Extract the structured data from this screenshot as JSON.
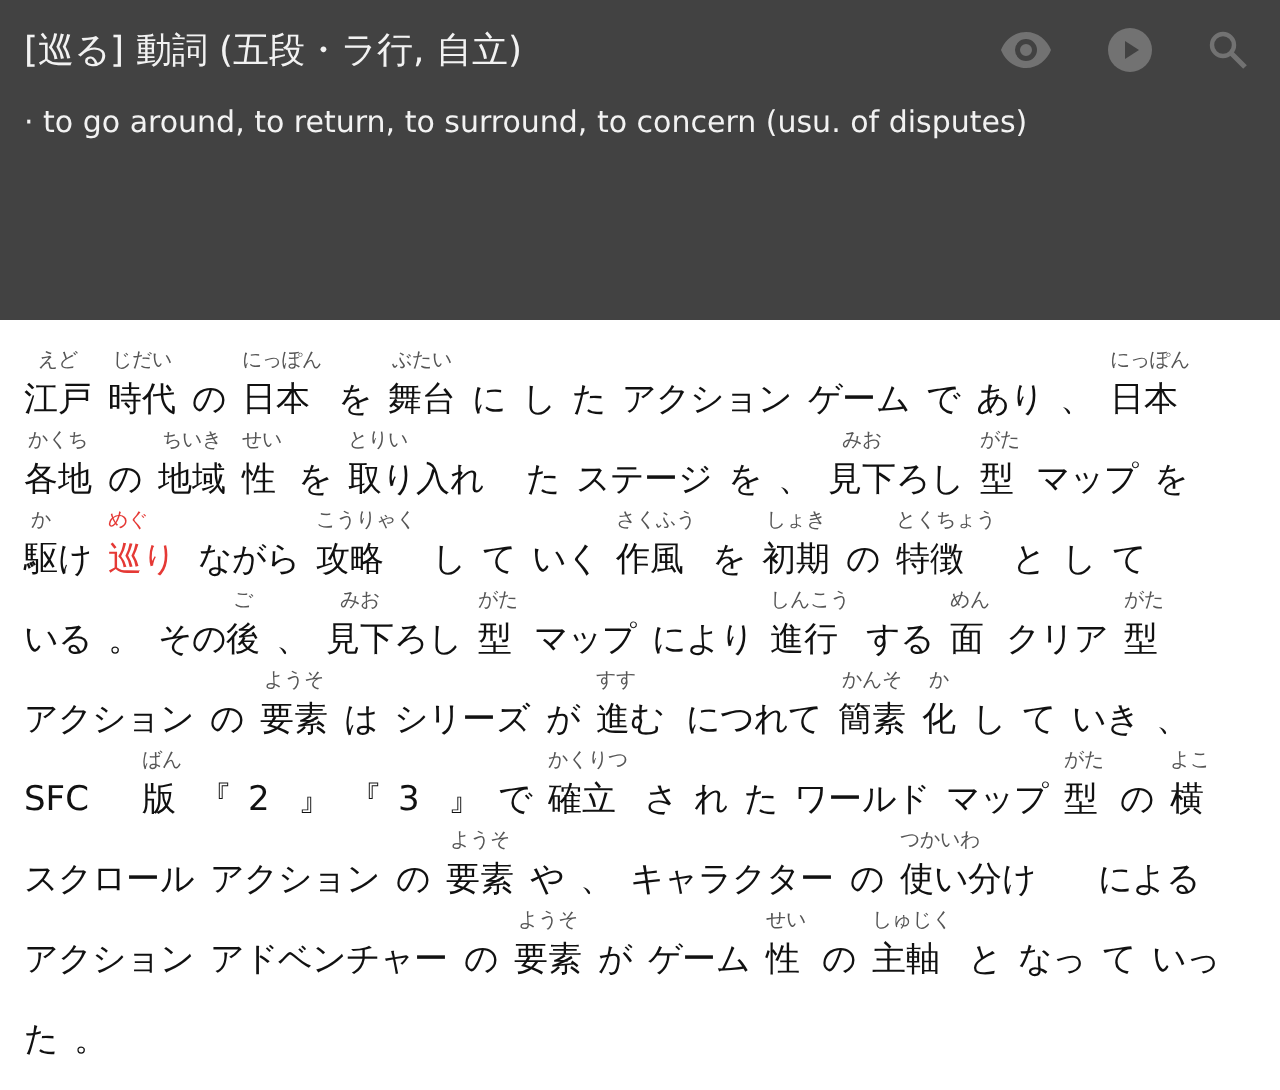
{
  "header": {
    "title": "[巡る] 動詞 (五段・ラ行, 自立)",
    "definition": "· to go around, to return, to surround, to concern (usu. of disputes)"
  },
  "lines": [
    [
      {
        "base": "江戸",
        "reading": "えど",
        "selected": false
      },
      {
        "base": "時代",
        "reading": "じだい",
        "selected": false
      },
      {
        "base": "の",
        "selected": false
      },
      {
        "base": "日本",
        "reading": "にっぽん",
        "selected": false
      },
      {
        "base": "を",
        "selected": false
      },
      {
        "base": "舞台",
        "reading": "ぶたい",
        "selected": false
      },
      {
        "base": "に",
        "selected": false
      },
      {
        "base": "し",
        "selected": false
      },
      {
        "base": "た",
        "selected": false
      },
      {
        "base": "アクション",
        "selected": false
      },
      {
        "base": "ゲーム",
        "selected": false
      },
      {
        "base": "で",
        "selected": false
      },
      {
        "base": "あり",
        "selected": false
      },
      {
        "base": "、",
        "selected": false
      },
      {
        "base": "日本",
        "reading": "にっぽん",
        "selected": false
      }
    ],
    [
      {
        "base": "各地",
        "reading": "かくち",
        "selected": false
      },
      {
        "base": "の",
        "selected": false
      },
      {
        "base": "地域",
        "reading": "ちいき",
        "selected": false
      },
      {
        "base": "性",
        "reading": "せい",
        "selected": false
      },
      {
        "base": "を",
        "selected": false
      },
      {
        "base": "取",
        "reading": "とりい",
        "tail": "り入れ",
        "selected": false
      },
      {
        "base": "た",
        "selected": false
      },
      {
        "base": "ステージ",
        "selected": false
      },
      {
        "base": "を",
        "selected": false
      },
      {
        "base": "、",
        "selected": false
      },
      {
        "base": "見下",
        "reading": "みお",
        "tail": "ろし",
        "selected": false
      },
      {
        "base": "型",
        "reading": "がた",
        "selected": false
      },
      {
        "base": "マップ",
        "selected": false
      },
      {
        "base": "を",
        "selected": false
      }
    ],
    [
      {
        "base": "駆",
        "reading": "か",
        "tail": "け",
        "selected": false
      },
      {
        "base": "巡",
        "reading": "めぐ",
        "tail": "り",
        "selected": true
      },
      {
        "base": "ながら",
        "selected": false
      },
      {
        "base": "攻略",
        "reading": "こうりゃく",
        "selected": false
      },
      {
        "base": "し",
        "selected": false
      },
      {
        "base": "て",
        "selected": false
      },
      {
        "base": "いく",
        "selected": false
      },
      {
        "base": "作風",
        "reading": "さくふう",
        "selected": false
      },
      {
        "base": "を",
        "selected": false
      },
      {
        "base": "初期",
        "reading": "しょき",
        "selected": false
      },
      {
        "base": "の",
        "selected": false
      },
      {
        "base": "特徴",
        "reading": "とくちょう",
        "selected": false
      },
      {
        "base": "と",
        "selected": false
      },
      {
        "base": "し",
        "selected": false
      },
      {
        "base": "て",
        "selected": false
      }
    ],
    [
      {
        "base": "いる",
        "selected": false
      },
      {
        "base": "。",
        "selected": false
      },
      {
        "head": "その",
        "base": "後",
        "reading": "ご",
        "selected": false
      },
      {
        "base": "、",
        "selected": false
      },
      {
        "base": "見下",
        "reading": "みお",
        "tail": "ろし",
        "selected": false
      },
      {
        "base": "型",
        "reading": "がた",
        "selected": false
      },
      {
        "base": "マップ",
        "selected": false
      },
      {
        "base": "により",
        "selected": false
      },
      {
        "base": "進行",
        "reading": "しんこう",
        "selected": false
      },
      {
        "base": "する",
        "selected": false
      },
      {
        "base": "面",
        "reading": "めん",
        "selected": false
      },
      {
        "base": "クリア",
        "selected": false
      },
      {
        "base": "型",
        "reading": "がた",
        "selected": false
      }
    ],
    [
      {
        "base": "アクション",
        "selected": false
      },
      {
        "base": "の",
        "selected": false
      },
      {
        "base": "要素",
        "reading": "ようそ",
        "selected": false
      },
      {
        "base": "は",
        "selected": false
      },
      {
        "base": "シリーズ",
        "selected": false
      },
      {
        "base": "が",
        "selected": false
      },
      {
        "base": "進",
        "reading": "すす",
        "tail": "む",
        "selected": false
      },
      {
        "base": "につれて",
        "selected": false
      },
      {
        "base": "簡素",
        "reading": "かんそ",
        "selected": false
      },
      {
        "base": "化",
        "reading": "か",
        "selected": false
      },
      {
        "base": "し",
        "selected": false
      },
      {
        "base": "て",
        "selected": false
      },
      {
        "base": "いき",
        "selected": false
      },
      {
        "base": "、",
        "selected": false
      }
    ],
    [
      {
        "base": "SFC",
        "selected": false
      },
      {
        "base": "版",
        "reading": "ばん",
        "selected": false
      },
      {
        "base": "『",
        "selected": false
      },
      {
        "base": "2",
        "selected": false
      },
      {
        "base": "』",
        "selected": false
      },
      {
        "base": "『",
        "selected": false
      },
      {
        "base": "3",
        "selected": false
      },
      {
        "base": "』",
        "selected": false
      },
      {
        "base": "で",
        "selected": false
      },
      {
        "base": "確立",
        "reading": "かくりつ",
        "selected": false
      },
      {
        "base": "さ",
        "selected": false
      },
      {
        "base": "れ",
        "selected": false
      },
      {
        "base": "た",
        "selected": false
      },
      {
        "base": "ワールド",
        "selected": false
      },
      {
        "base": "マップ",
        "selected": false
      },
      {
        "base": "型",
        "reading": "がた",
        "selected": false
      },
      {
        "base": "の",
        "selected": false
      },
      {
        "base": "横",
        "reading": "よこ",
        "selected": false
      }
    ],
    [
      {
        "base": "スクロール",
        "selected": false
      },
      {
        "base": "アクション",
        "selected": false
      },
      {
        "base": "の",
        "selected": false
      },
      {
        "base": "要素",
        "reading": "ようそ",
        "selected": false
      },
      {
        "base": "や",
        "selected": false
      },
      {
        "base": "、",
        "selected": false
      },
      {
        "base": "キャラクター",
        "selected": false
      },
      {
        "base": "の",
        "selected": false
      },
      {
        "base": "使",
        "reading": "つかいわ",
        "tail": "い分け",
        "selected": false
      },
      {
        "base": "による",
        "selected": false
      }
    ],
    [
      {
        "base": "アクション",
        "selected": false
      },
      {
        "base": "アドベンチャー",
        "selected": false
      },
      {
        "base": "の",
        "selected": false
      },
      {
        "base": "要素",
        "reading": "ようそ",
        "selected": false
      },
      {
        "base": "が",
        "selected": false
      },
      {
        "base": "ゲーム",
        "selected": false
      },
      {
        "base": "性",
        "reading": "せい",
        "selected": false
      },
      {
        "base": "の",
        "selected": false
      },
      {
        "base": "主軸",
        "reading": "しゅじく",
        "selected": false
      },
      {
        "base": "と",
        "selected": false
      },
      {
        "base": "なっ",
        "selected": false
      },
      {
        "base": "て",
        "selected": false
      },
      {
        "base": "いっ",
        "selected": false
      }
    ],
    [
      {
        "base": "た",
        "selected": false
      },
      {
        "base": "。",
        "selected": false
      }
    ]
  ]
}
